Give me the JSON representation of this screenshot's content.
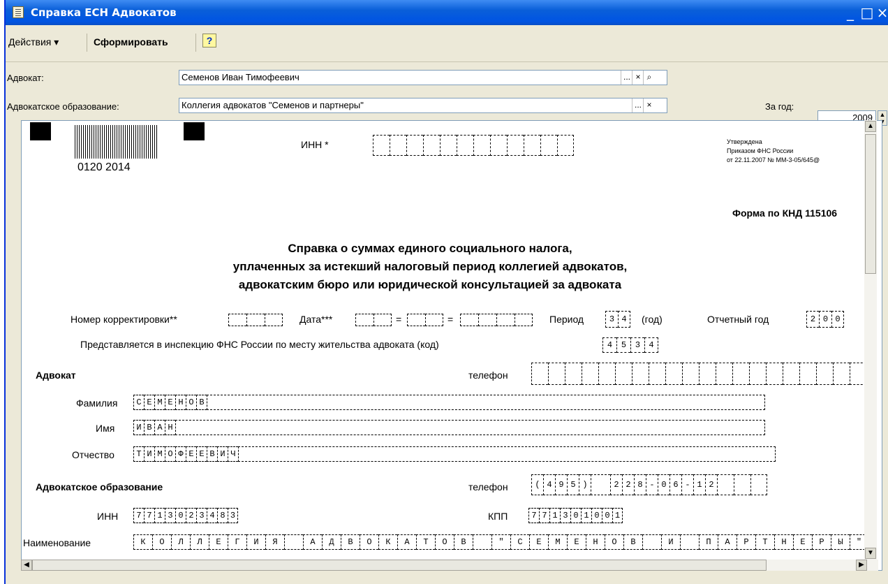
{
  "window": {
    "title": "Справка ЕСН Адвокатов",
    "min_icon": "minimize-icon",
    "max_icon": "maximize-icon",
    "close_icon": "close-icon"
  },
  "menu": {
    "actions_label": "Действия",
    "actions_arrow": "▾",
    "generate_label": "Сформировать",
    "help_label": "?"
  },
  "fields": {
    "lawyer_label": "Адвокат:",
    "lawyer_value": "Семенов Иван Тимофеевич",
    "org_label": "Адвокатское образование:",
    "org_value": "Коллегия адвокатов \"Семенов и партнеры\"",
    "year_label": "За год:",
    "year_value": "2009",
    "select_btn": "...",
    "clear_btn": "×",
    "search_btn": "🔍"
  },
  "form": {
    "barcode_text": "0120 2014",
    "inn_label": "ИНН *",
    "approved": [
      "Утверждена",
      "Приказом ФНС России",
      "от 22.11.2007 № ММ-3-05/645@"
    ],
    "knd": "Форма по КНД 115106",
    "title_lines": [
      "Справка о суммах единого социального налога,",
      "уплаченных за истекший налоговый период коллегией адвокатов,",
      "адвокатским бюро или юридической консультацией за адвоката"
    ],
    "correction_label": "Номер корректировки**",
    "date_label": "Дата***",
    "date_sep": "=",
    "period_label": "Период",
    "period_cells": [
      "3",
      "4"
    ],
    "period_unit": "(год)",
    "report_year_label": "Отчетный год",
    "report_year_cells": [
      "2",
      "0",
      "0"
    ],
    "inspection_label": "Представляется в инспекцию ФНС России по месту жительства адвоката (код)",
    "inspection_cells": [
      "4",
      "5",
      "3",
      "4"
    ],
    "lawyer_section": "Адвокат",
    "phone_label": "телефон",
    "surname_label": "Фамилия",
    "surname_cells": [
      "С",
      "Е",
      "М",
      "Е",
      "Н",
      "О",
      "В"
    ],
    "name_label": "Имя",
    "name_cells": [
      "И",
      "В",
      "А",
      "Н"
    ],
    "patronymic_label": "Отчество",
    "patronymic_cells": [
      "Т",
      "И",
      "М",
      "О",
      "Ф",
      "Е",
      "Е",
      "В",
      "И",
      "Ч"
    ],
    "org_section": "Адвокатское образование",
    "org_phone_cells": [
      "(",
      "4",
      "9",
      "5",
      ")",
      " ",
      "2",
      "2",
      "8",
      "-",
      "0",
      "6",
      "-",
      "1",
      "2"
    ],
    "org_inn_label": "ИНН",
    "org_inn_cells": [
      "7",
      "7",
      "1",
      "3",
      "0",
      "2",
      "3",
      "4",
      "8",
      "3"
    ],
    "kpp_label": "КПП",
    "kpp_cells": [
      "7",
      "7",
      "1",
      "3",
      "0",
      "1",
      "0",
      "0",
      "1"
    ],
    "org_name_label": "Наименование",
    "org_name_cells": [
      "К",
      "О",
      "Л",
      "Л",
      "Е",
      "Г",
      "И",
      "Я",
      " ",
      "А",
      "Д",
      "В",
      "О",
      "К",
      "А",
      "Т",
      "О",
      "В",
      " ",
      "\"",
      "С",
      "Е",
      "М",
      "Е",
      "Н",
      "О",
      "В",
      " ",
      "И",
      " ",
      "П",
      "А",
      "Р",
      "Т",
      "Н",
      "Е",
      "Р",
      "Ы",
      "\""
    ]
  }
}
